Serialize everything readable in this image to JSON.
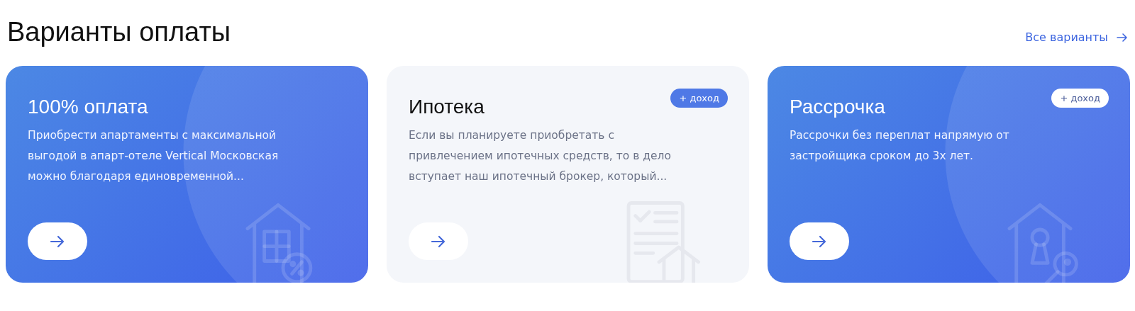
{
  "heading": "Варианты оплаты",
  "all_link": {
    "label": "Все варианты"
  },
  "cards": [
    {
      "kind": "blue",
      "title": "100% оплата",
      "text": "Приобрести апартаменты с максимальной выгодой в апарт-отеле Vertical Московская можно благодаря единовременной...",
      "illustration": {
        "kind": "house-percent"
      }
    },
    {
      "kind": "light",
      "title": "Ипотека",
      "badge": "+ доход",
      "text": "Если вы планируете приобретать с привлечением ипотечных средств, то в дело вступает наш ипотечный брокер, который...",
      "illustration": {
        "kind": "document-house"
      }
    },
    {
      "kind": "blue",
      "title": "Рассрочка",
      "badge": "+ доход",
      "text": "Рассрочки без переплат напрямую от застройщика сроком до 3х лет.",
      "illustration": {
        "kind": "house-key"
      }
    }
  ]
}
